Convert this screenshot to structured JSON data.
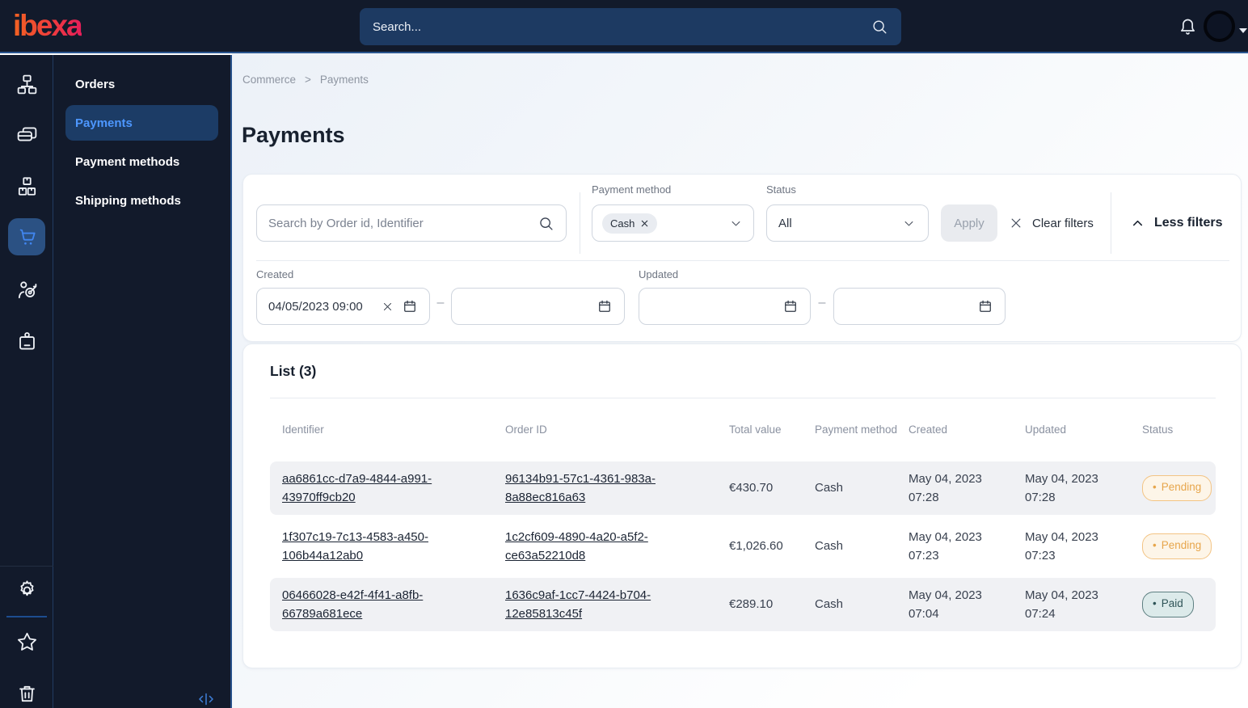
{
  "topbar": {
    "logo_text": "ibexa",
    "search_placeholder": "Search..."
  },
  "sidebar": {
    "icons": [
      {
        "name": "content-structure"
      },
      {
        "name": "pages"
      },
      {
        "name": "product-catalog"
      },
      {
        "name": "commerce-cart",
        "active": true
      },
      {
        "name": "personalization-target"
      },
      {
        "name": "company-badge"
      },
      {
        "name": "settings-gear"
      },
      {
        "name": "bookmarks-star"
      },
      {
        "name": "trash"
      }
    ]
  },
  "submenu": {
    "items": [
      {
        "label": "Orders",
        "active": false
      },
      {
        "label": "Payments",
        "active": true
      },
      {
        "label": "Payment methods",
        "active": false
      },
      {
        "label": "Shipping methods",
        "active": false
      }
    ]
  },
  "breadcrumb": {
    "items": [
      "Commerce",
      "Payments"
    ],
    "separator": ">"
  },
  "page": {
    "title": "Payments"
  },
  "filters": {
    "search_placeholder": "Search by Order id, Identifier",
    "payment_method_label": "Payment method",
    "payment_method_chip": "Cash",
    "status_label": "Status",
    "status_value": "All",
    "apply_label": "Apply",
    "clear_label": "Clear filters",
    "toggle_label": "Less filters",
    "created_label": "Created",
    "created_from": "04/05/2023 09:00",
    "updated_label": "Updated",
    "range_separator": "–"
  },
  "list": {
    "title": "List (3)",
    "columns": [
      "Identifier",
      "Order ID",
      "Total value",
      "Payment method",
      "Created",
      "Updated",
      "Status"
    ],
    "rows": [
      {
        "identifier": "aa6861cc-d7a9-4844-a991-43970ff9cb20",
        "order_id": "96134b91-57c1-4361-983a-8a88ec816a63",
        "total_value": "€430.70",
        "payment_method": "Cash",
        "created": "May 04, 2023 07:28",
        "updated": "May 04, 2023 07:28",
        "status": "Pending",
        "status_variant": "pending"
      },
      {
        "identifier": "1f307c19-7c13-4583-a450-106b44a12ab0",
        "order_id": "1c2cf609-4890-4a20-a5f2-ce63a52210d8",
        "total_value": "€1,026.60",
        "payment_method": "Cash",
        "created": "May 04, 2023 07:23",
        "updated": "May 04, 2023 07:23",
        "status": "Pending",
        "status_variant": "pending"
      },
      {
        "identifier": "06466028-e42f-4f41-a8fb-66789a681ece",
        "order_id": "1636c9af-1cc7-4424-b704-12e85813c45f",
        "total_value": "€289.10",
        "payment_method": "Cash",
        "created": "May 04, 2023 07:04",
        "updated": "May 04, 2023 07:24",
        "status": "Paid",
        "status_variant": "paid"
      }
    ]
  },
  "colors": {
    "accent_blue": "#4d97ff",
    "pending": "#e7a64c",
    "paid": "#2f5457",
    "logo_gradient_start": "#f26322",
    "logo_gradient_end": "#e61e5a",
    "topbar_bg": "#121a2b"
  }
}
